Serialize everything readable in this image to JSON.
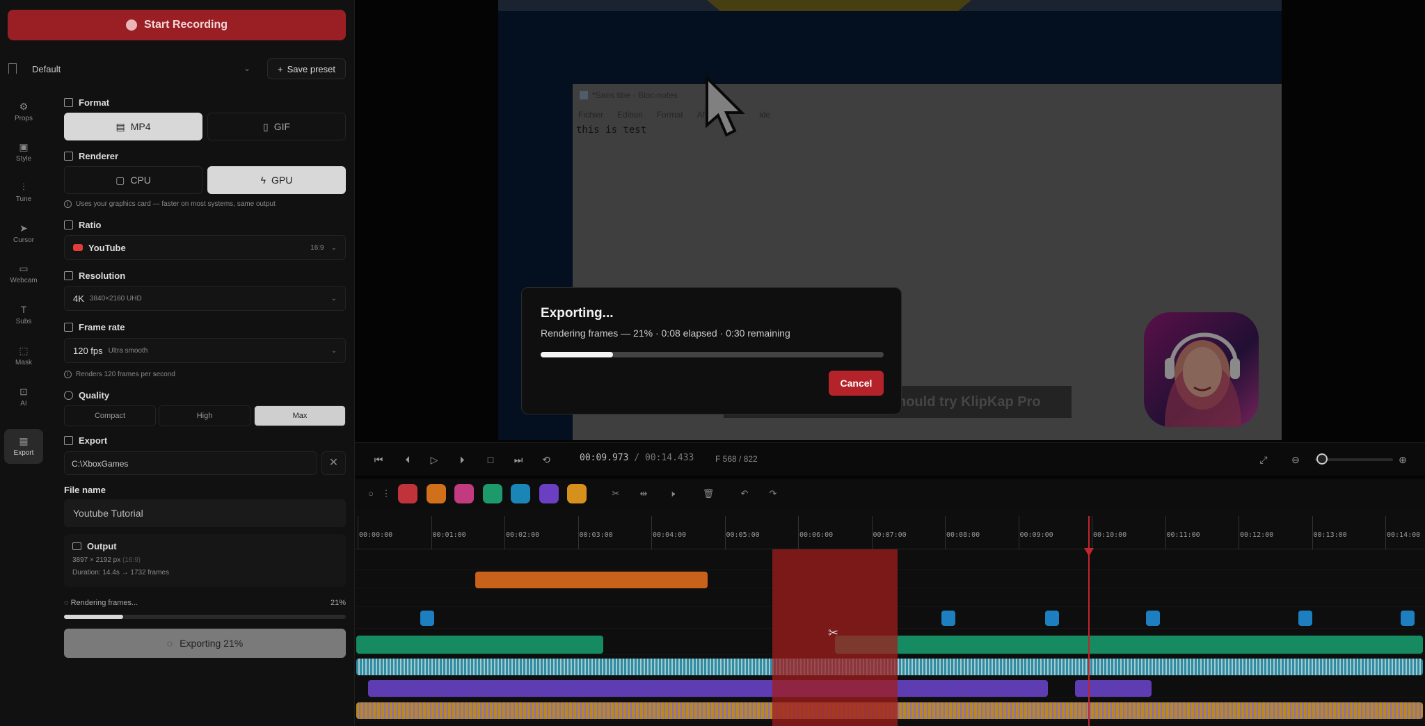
{
  "recording": {
    "start_label": "Start Recording"
  },
  "preset": {
    "selected": "Default",
    "save_label": "Save preset"
  },
  "rail": [
    {
      "label": "Props",
      "icon": "gear-icon"
    },
    {
      "label": "Style",
      "icon": "image-icon"
    },
    {
      "label": "Tune",
      "icon": "sliders-icon"
    },
    {
      "label": "Cursor",
      "icon": "cursor-icon"
    },
    {
      "label": "Webcam",
      "icon": "webcam-icon"
    },
    {
      "label": "Subs",
      "icon": "text-icon"
    },
    {
      "label": "Mask",
      "icon": "mask-icon"
    },
    {
      "label": "AI",
      "icon": "robot-icon"
    },
    {
      "label": "Export",
      "icon": "export-icon",
      "active": true
    }
  ],
  "format": {
    "title": "Format",
    "options": [
      "MP4",
      "GIF"
    ],
    "selected": "MP4"
  },
  "renderer": {
    "title": "Renderer",
    "options": [
      "CPU",
      "GPU"
    ],
    "selected": "GPU",
    "hint": "Uses your graphics card — faster on most systems, same output"
  },
  "ratio": {
    "title": "Ratio",
    "value": "YouTube",
    "badge": "16:9"
  },
  "resolution": {
    "title": "Resolution",
    "value": "4K",
    "sub": "3840×2160 UHD"
  },
  "framerate": {
    "title": "Frame rate",
    "value": "120 fps",
    "sub": "Ultra smooth",
    "hint": "Renders 120 frames per second"
  },
  "quality": {
    "title": "Quality",
    "options": [
      "Compact",
      "High",
      "Max"
    ],
    "selected": "Max"
  },
  "export": {
    "title": "Export",
    "path": "C:\\XboxGames"
  },
  "filename": {
    "label": "File name",
    "value": "Youtube Tutorial"
  },
  "output": {
    "title": "Output",
    "dims": "3897 × 2192 px",
    "dims_ratio": "(16:9)",
    "duration": "Duration: 14.4s  → 1732 frames"
  },
  "render_status": {
    "label": "Rendering frames...",
    "percent_label": "21%",
    "progress": 0.21
  },
  "exporting_button": {
    "label": "Exporting 21%"
  },
  "preview": {
    "notepad_title": "*Sans titre - Bloc-notes",
    "notepad_menu": [
      "Fichier",
      "Edition",
      "Format",
      "Af",
      "ide"
    ],
    "notepad_text": "this is test",
    "banner": "hould try KlipKap Pro"
  },
  "transport": {
    "current": "00:09.973",
    "separator": "/",
    "total": "00:14.433",
    "frame": "F 568 / 822"
  },
  "timeline": {
    "ticks": [
      "00:00:00",
      "00:01:00",
      "00:02:00",
      "00:03:00",
      "00:04:00",
      "00:05:00",
      "00:06:00",
      "00:07:00",
      "00:08:00",
      "00:09:00",
      "00:10:00",
      "00:11:00",
      "00:12:00",
      "00:13:00",
      "00:14:00"
    ],
    "chip_colors": [
      "#c0333b",
      "#d0701a",
      "#c23a7f",
      "#1d9a6c",
      "#1a86b8",
      "#6a3fc2",
      "#d6901c"
    ]
  },
  "modal": {
    "title": "Exporting...",
    "message": "Rendering frames — 21% · 0:08 elapsed · 0:30 remaining",
    "progress": 0.21,
    "cancel_label": "Cancel"
  }
}
